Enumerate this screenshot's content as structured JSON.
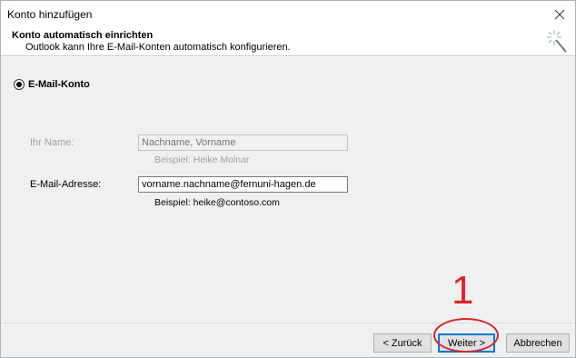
{
  "window": {
    "title": "Konto hinzufügen"
  },
  "header": {
    "title": "Konto automatisch einrichten",
    "subtitle": "Outlook kann Ihre E-Mail-Konten automatisch konfigurieren.",
    "icon": "magic-wand-icon"
  },
  "form": {
    "account_type_label": "E-Mail-Konto",
    "name_label": "Ihr Name:",
    "name_placeholder": "Nachname, Vorname",
    "name_example": "Beispiel: Heike Molnar",
    "email_label": "E-Mail-Adresse:",
    "email_value": "vorname.nachname@fernuni-hagen.de",
    "email_example": "Beispiel: heike@contoso.com"
  },
  "buttons": {
    "back": "< Zurück",
    "next": "Weiter >",
    "cancel": "Abbrechen"
  },
  "annotation": {
    "number": "1",
    "color": "#e0232b"
  },
  "colors": {
    "accent": "#0078d7",
    "annotation": "#d9252b"
  }
}
